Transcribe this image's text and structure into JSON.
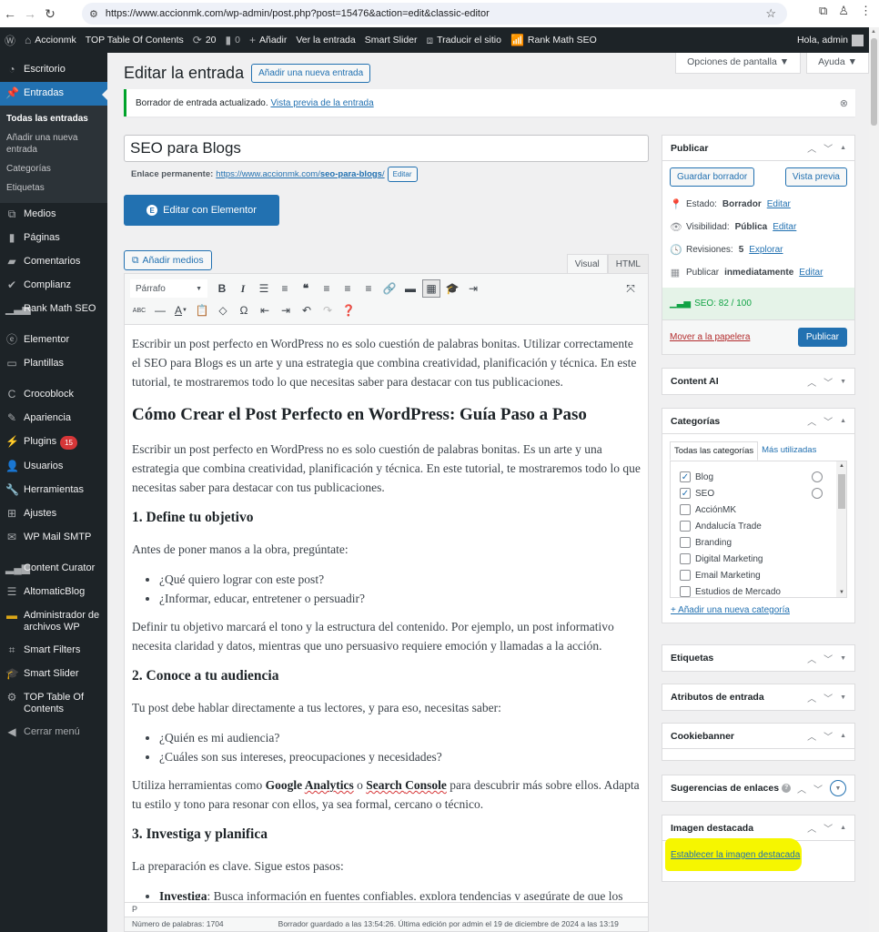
{
  "browser": {
    "url": "https://www.accionmk.com/wp-admin/post.php?post=15476&action=edit&classic-editor",
    "icons": [
      "back-icon",
      "forward-icon",
      "reload-icon",
      "site-settings-icon",
      "bookmark-star-icon",
      "extensions-icon",
      "profile-icon",
      "menu-icon"
    ]
  },
  "adminbar": {
    "site_name": "Accionmk",
    "toc": "TOP Table Of Contents",
    "updates": "20",
    "comments": "0",
    "add_new": "Añadir",
    "view_post": "Ver la entrada",
    "smart_slider": "Smart Slider",
    "translate": "Traducir el sitio",
    "rank_math": "Rank Math SEO",
    "greeting": "Hola, admin"
  },
  "sidebar": {
    "items": [
      {
        "label": "Escritorio",
        "icon": "dashboard-icon"
      },
      {
        "label": "Entradas",
        "icon": "pin-icon",
        "active": true
      },
      {
        "label": "Medios",
        "icon": "media-icon"
      },
      {
        "label": "Páginas",
        "icon": "pages-icon"
      },
      {
        "label": "Comentarios",
        "icon": "comments-icon"
      },
      {
        "label": "Complianz",
        "icon": "check-icon"
      },
      {
        "label": "Rank Math SEO",
        "icon": "rankmath-icon"
      },
      {
        "label": "Elementor",
        "icon": "elementor-icon"
      },
      {
        "label": "Plantillas",
        "icon": "folder-icon"
      },
      {
        "label": "Crocoblock",
        "icon": "crocoblock-icon"
      },
      {
        "label": "Apariencia",
        "icon": "brush-icon"
      },
      {
        "label": "Plugins",
        "icon": "plugin-icon",
        "badge": "15"
      },
      {
        "label": "Usuarios",
        "icon": "users-icon"
      },
      {
        "label": "Herramientas",
        "icon": "wrench-icon"
      },
      {
        "label": "Ajustes",
        "icon": "settings-icon"
      },
      {
        "label": "WP Mail SMTP",
        "icon": "mail-icon"
      },
      {
        "label": "Content Curator",
        "icon": "bars-icon"
      },
      {
        "label": "AltomaticBlog",
        "icon": "list-icon"
      },
      {
        "label": "Administrador de archivos WP",
        "icon": "file-manager-icon"
      },
      {
        "label": "Smart Filters",
        "icon": "filters-icon"
      },
      {
        "label": "Smart Slider",
        "icon": "mortarboard-icon"
      },
      {
        "label": "TOP Table Of Contents",
        "icon": "gear-icon"
      }
    ],
    "submenu": [
      "Todas las entradas",
      "Añadir una nueva entrada",
      "Categorías",
      "Etiquetas"
    ],
    "collapse": "Cerrar menú"
  },
  "header": {
    "screen_options": "Opciones de pantalla ▼",
    "help": "Ayuda ▼",
    "title": "Editar la entrada",
    "add_new": "Añadir una nueva entrada"
  },
  "notice": {
    "text": "Borrador de entrada actualizado.",
    "link": "Vista previa de la entrada"
  },
  "post": {
    "title": "SEO para Blogs",
    "permalink_label": "Enlace permanente:",
    "permalink_base": "https://www.accionmk.com/",
    "permalink_slug": "seo-para-blogs",
    "permalink_edit": "Editar",
    "elementor_button": "Editar con Elementor",
    "add_media": "Añadir medios",
    "tab_visual": "Visual",
    "tab_html": "HTML",
    "format_select": "Párrafo"
  },
  "content": {
    "p1": "Escribir un post perfecto en WordPress no es solo cuestión de palabras bonitas. Utilizar correctamente el SEO para Blogs es un arte y una estrategia que combina creatividad, planificación y técnica. En este tutorial, te mostraremos todo lo que necesitas saber para destacar con tus publicaciones.",
    "h2": "Cómo Crear el Post Perfecto en WordPress: Guía Paso a Paso",
    "p2": "Escribir un post perfecto en WordPress no es solo cuestión de palabras bonitas. Es un arte y una estrategia que combina creatividad, planificación y técnica. En este tutorial, te mostraremos todo lo que necesitas saber para destacar con tus publicaciones.",
    "h3a": "1. Define tu objetivo",
    "p3": "Antes de poner manos a la obra, pregúntate:",
    "list1": [
      "¿Qué quiero lograr con este post?",
      "¿Informar, educar, entretener o persuadir?"
    ],
    "p4": "Definir tu objetivo marcará el tono y la estructura del contenido. Por ejemplo, un post informativo necesita claridad y datos, mientras que uno persuasivo requiere emoción y llamadas a la acción.",
    "h3b": "2. Conoce a tu audiencia",
    "p5": "Tu post debe hablar directamente a tus lectores, y para eso, necesitas saber:",
    "list2": [
      "¿Quién es mi audiencia?",
      "¿Cuáles son sus intereses, preocupaciones y necesidades?"
    ],
    "p6_a": "Utiliza herramientas como ",
    "p6_b1": "Google ",
    "p6_b2": "Analytics",
    "p6_c": " o ",
    "p6_d1": "Search ",
    "p6_d2": "Console",
    "p6_e": " para descubrir más sobre ellos. Adapta tu estilo y tono para resonar con ellos, ya sea formal, cercano o técnico.",
    "h3c": "3. Investiga y planifica",
    "p7": "La preparación es clave. Sigue estos pasos:",
    "li3_bold": "Investiga",
    "li3_rest": ": Busca información en fuentes confiables, explora tendencias y asegúrate de que los"
  },
  "editor_footer": {
    "path": "P",
    "word_count": "Número de palabras: 1704",
    "saved": "Borrador guardado a las 13:54:26. Última edición por admin el 19 de diciembre de 2024 a las 13:19"
  },
  "publish": {
    "title": "Publicar",
    "save_draft": "Guardar borrador",
    "preview": "Vista previa",
    "status_label": "Estado:",
    "status_value": "Borrador",
    "visibility_label": "Visibilidad:",
    "visibility_value": "Pública",
    "revisions_label": "Revisiones:",
    "revisions_value": "5",
    "revisions_link": "Explorar",
    "publish_label": "Publicar",
    "publish_value": "inmediatamente",
    "edit": "Editar",
    "seo": "SEO: 82 / 100",
    "trash": "Mover a la papelera",
    "publish_button": "Publicar"
  },
  "boxes": {
    "content_ai": "Content AI",
    "categories": "Categorías",
    "tags": "Etiquetas",
    "attributes": "Atributos de entrada",
    "cookiebanner": "Cookiebanner",
    "link_suggestions": "Sugerencias de enlaces",
    "featured_image": "Imagen destacada",
    "set_featured": "Establecer la imagen destacada"
  },
  "categories": {
    "tab_all": "Todas las categorías",
    "tab_popular": "Más utilizadas",
    "items": [
      {
        "label": "Blog",
        "checked": true
      },
      {
        "label": "SEO",
        "checked": true
      },
      {
        "label": "AcciónMK",
        "checked": false
      },
      {
        "label": "Andalucía Trade",
        "checked": false
      },
      {
        "label": "Branding",
        "checked": false
      },
      {
        "label": "Digital Marketing",
        "checked": false
      },
      {
        "label": "Email Marketing",
        "checked": false
      },
      {
        "label": "Estudios de Mercado",
        "checked": false
      }
    ],
    "add_new": "+ Añadir una nueva categoría"
  },
  "colors": {
    "admin_dark": "#1d2327",
    "accent": "#2271b1",
    "success": "#00a32a",
    "danger": "#d63638",
    "highlight": "#f6f600"
  }
}
